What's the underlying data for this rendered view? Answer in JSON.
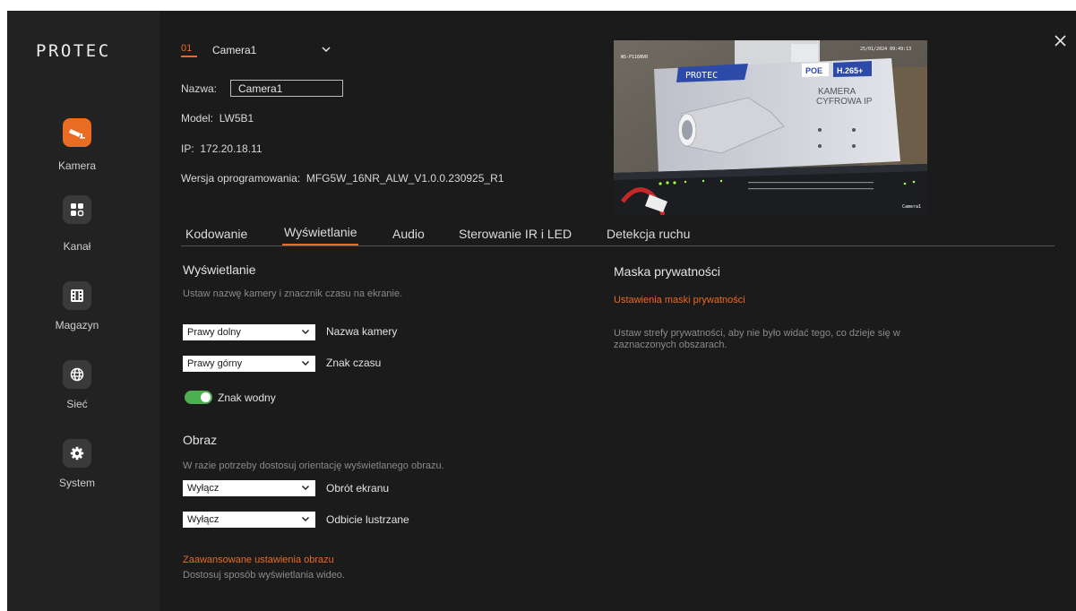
{
  "brand": {
    "logo_text": "PROTEC"
  },
  "sidebar": {
    "items": [
      {
        "id": "kamera",
        "label": "Kamera",
        "icon": "camera-icon",
        "active": true
      },
      {
        "id": "kanal",
        "label": "Kanał",
        "icon": "grid-icon",
        "active": false
      },
      {
        "id": "magazyn",
        "label": "Magazyn",
        "icon": "film-icon",
        "active": false
      },
      {
        "id": "siec",
        "label": "Sieć",
        "icon": "globe-icon",
        "active": false
      },
      {
        "id": "system",
        "label": "System",
        "icon": "gear-icon",
        "active": false
      }
    ]
  },
  "camera_selector": {
    "number": "01",
    "name": "Camera1",
    "icon": "chevron-down-icon"
  },
  "camera_info": {
    "name_label": "Nazwa:",
    "name_value": "Camera1",
    "model_label": "Model:",
    "model_value": "LW5B1",
    "ip_label": "IP:",
    "ip_value": "172.20.18.11",
    "firmware_label": "Wersja oprogramowania:",
    "firmware_value": "MFG5W_16NR_ALW_V1.0.0.230925_R1"
  },
  "preview": {
    "timestamp": "25/01/2024 09:49:13",
    "overlay_name": "Camera1",
    "top_left_text": "WS-P116NVR",
    "box_logo": "PROTEC",
    "box_poe": "POE",
    "box_codec": "H.265+",
    "box_text_line1": "KAMERA",
    "box_text_line2": "CYFROWA IP"
  },
  "tabs": [
    {
      "label": "Kodowanie",
      "active": false
    },
    {
      "label": "Wyświetlanie",
      "active": true
    },
    {
      "label": "Audio",
      "active": false
    },
    {
      "label": "Sterowanie IR i LED",
      "active": false
    },
    {
      "label": "Detekcja ruchu",
      "active": false
    }
  ],
  "display_section": {
    "title": "Wyświetlanie",
    "description": "Ustaw nazwę kamery i znacznik czasu na ekranie.",
    "camera_name_position": {
      "value": "Prawy dolny",
      "label": "Nazwa kamery"
    },
    "time_position": {
      "value": "Prawy górny",
      "label": "Znak czasu"
    },
    "watermark": {
      "label": "Znak wodny",
      "enabled": true
    }
  },
  "image_section": {
    "title": "Obraz",
    "description": "W razie potrzeby dostosuj orientację wyświetlanego obrazu.",
    "rotation": {
      "value": "Wyłącz",
      "label": "Obrót ekranu"
    },
    "mirror": {
      "value": "Wyłącz",
      "label": "Odbicie lustrzane"
    },
    "advanced_link": "Zaawansowane ustawienia obrazu",
    "advanced_desc": "Dostosuj sposób wyświetlania wideo."
  },
  "privacy_section": {
    "title": "Maska prywatności",
    "link": "Ustawienia maski prywatności",
    "description": "Ustaw strefy prywatności, aby nie było widać tego, co dzieje się w zaznaczonych obszarach."
  },
  "colors": {
    "accent": "#ea6b22",
    "toggle_on": "#4caf50",
    "background": "#1b1b1b",
    "sidebar": "#222222"
  }
}
